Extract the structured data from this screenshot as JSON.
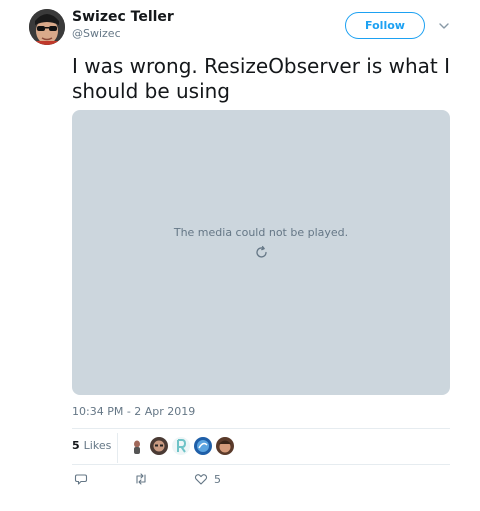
{
  "author": {
    "name": "Swizec Teller",
    "handle": "@Swizec"
  },
  "follow_label": "Follow",
  "tweet_text": "I was wrong. ResizeObserver is what I should be using",
  "media": {
    "message": "The media could not be played.",
    "retry_icon": "retry-icon",
    "background": "#ccd6dd"
  },
  "timestamp": "10:34 PM - 2 Apr 2019",
  "likes": {
    "count": "5",
    "label": "Likes",
    "avatars": [
      "liker-1",
      "liker-2",
      "liker-3",
      "liker-4",
      "liker-5"
    ]
  },
  "actions": {
    "reply_icon": "reply-icon",
    "retweet_icon": "retweet-icon",
    "like_icon": "heart-icon",
    "like_count": "5"
  },
  "colors": {
    "accent": "#1da1f2",
    "secondary_text": "#657786",
    "divider": "#e6ecf0"
  }
}
